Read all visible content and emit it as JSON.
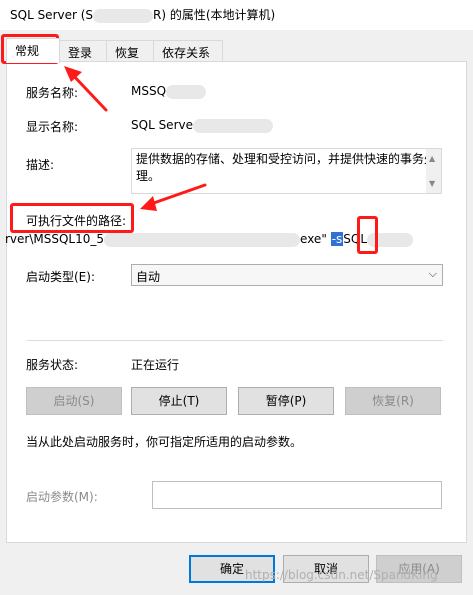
{
  "window": {
    "title_prefix": "SQL Server (S",
    "title_suffix": "R) 的属性(本地计算机)"
  },
  "tabs": [
    {
      "label": "常规"
    },
    {
      "label": "登录"
    },
    {
      "label": "恢复"
    },
    {
      "label": "依存关系"
    }
  ],
  "fields": {
    "service_name": {
      "label": "服务名称:",
      "value": "MSSQ"
    },
    "display_name": {
      "label": "显示名称:",
      "value": "SQL Serve"
    },
    "description": {
      "label": "描述:",
      "value": "提供数据的存储、处理和受控访问，并提供快速的事务处理。"
    },
    "exec_path": {
      "label": "可执行文件的路径:",
      "value_start": "rver\\MSSQL10_5",
      "value_mid": "exe",
      "value_quote": "\"",
      "value_highlight": "-s",
      "value_end": "SQL"
    },
    "startup_type": {
      "label": "启动类型(E):",
      "value": "自动"
    },
    "service_status": {
      "label": "服务状态:",
      "value": "正在运行"
    }
  },
  "buttons": {
    "start": "启动(S)",
    "stop": "停止(T)",
    "pause": "暂停(P)",
    "resume": "恢复(R)"
  },
  "hint": "当从此处启动服务时，你可指定所适用的启动参数。",
  "start_params": {
    "label": "启动参数(M):",
    "value": ""
  },
  "footer": {
    "ok": "确定",
    "cancel": "取消",
    "apply": "应用(A)"
  },
  "watermark": "https://blog.csdn.net/SpandKing",
  "colors": {
    "annotation": "#ff1a1a",
    "selection": "#3071d6",
    "focus": "#0078d7"
  }
}
